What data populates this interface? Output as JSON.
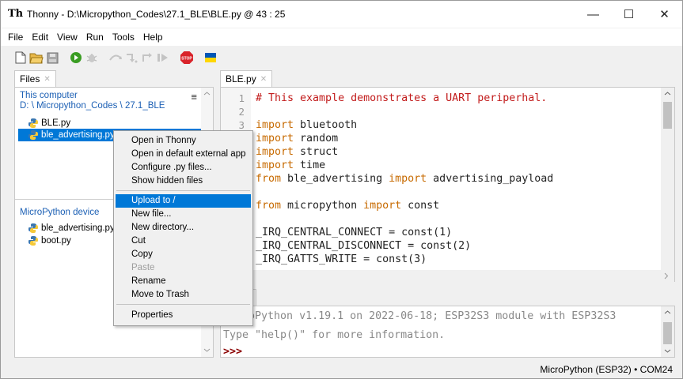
{
  "window": {
    "title": "Thonny  -  D:\\Micropython_Codes\\27.1_BLE\\BLE.py  @  43 : 25",
    "minimize": "—",
    "maximize": "☐",
    "close": "✕"
  },
  "menu": [
    "File",
    "Edit",
    "View",
    "Run",
    "Tools",
    "Help"
  ],
  "toolbar": {
    "icons": [
      "new-file-icon",
      "open-folder-icon",
      "save-icon",
      "run-icon",
      "debug-icon",
      "step-over-icon",
      "step-into-icon",
      "step-out-icon",
      "resume-icon",
      "stop-icon",
      "ukraine-flag-icon"
    ],
    "stop_label": "STOP"
  },
  "files": {
    "tab_label": "Files",
    "tab_close": "✕",
    "computer_title": "This computer",
    "computer_path": "D: \\ Micropython_Codes \\ 27.1_BLE",
    "menu_icon": "≡",
    "computer_files": [
      "BLE.py",
      "ble_advertising.py"
    ],
    "device_title": "MicroPython device",
    "device_files": [
      "ble_advertising.py",
      "boot.py"
    ]
  },
  "editor": {
    "tab_label": "BLE.py",
    "tab_close": "✕",
    "line_numbers": [
      "1",
      "2",
      "3"
    ],
    "line1_comment": "# This example demonstrates a UART periperhal.",
    "kw_import": "import",
    "kw_from": "from",
    "mod_bluetooth": " bluetooth",
    "mod_random": " random",
    "mod_struct": " struct",
    "mod_time": " time",
    "mod_ble_adv": " ble_advertising ",
    "mod_adv_payload": " advertising_payload",
    "mod_micropython": " micropython ",
    "mod_const": " const",
    "line_irq1": "_IRQ_CENTRAL_CONNECT = const(1)",
    "line_irq2": "_IRQ_CENTRAL_DISCONNECT = const(2)",
    "line_irq3": "_IRQ_GATTS_WRITE = const(3)"
  },
  "shell": {
    "banner": "MicroPython v1.19.1 on 2022-06-18; ESP32S3 module with ESP32S3",
    "hint": "Type \"help()\" for more information.",
    "prompt": ">>>"
  },
  "statusbar": {
    "text": "MicroPython (ESP32)  •  COM24"
  },
  "context_menu": {
    "items_group1": [
      "Open in Thonny",
      "Open in default external app",
      "Configure .py files...",
      "Show hidden files"
    ],
    "items_group2": [
      "Upload to /",
      "New file...",
      "New directory...",
      "Cut",
      "Copy",
      "Paste",
      "Rename",
      "Move to Trash"
    ],
    "items_group3": [
      "Properties"
    ],
    "highlighted": "Upload to /",
    "disabled": "Paste"
  },
  "colors": {
    "keyword": "#c76a00",
    "comment": "#c21b1b",
    "selection": "#0078d7",
    "link_blue": "#1b5fb4"
  }
}
